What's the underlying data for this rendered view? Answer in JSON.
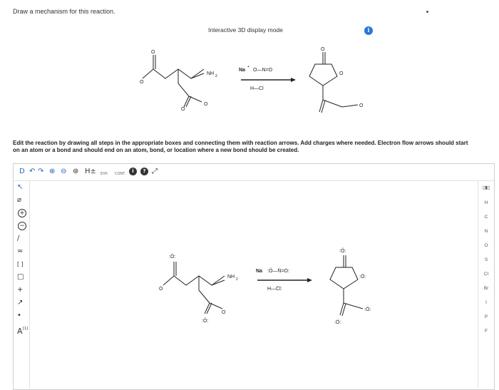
{
  "prompt": "Draw a mechanism for this reaction.",
  "display_mode_label": "Interactive 3D display mode",
  "info_badge": "i",
  "instructions": "Edit the reaction by drawing all steps in the appropriate boxes and connecting them with reaction arrows. Add charges where needed. Electron flow arrows should start on an atom or a bond and should end on an atom, bond, or location where a new bond should be created.",
  "reaction_top": {
    "reactant_amine": "NH",
    "reactant_amine_sub": "2",
    "o_minus": "O",
    "minus": "−",
    "o_label": "O",
    "reagent_cation": "Na",
    "plus": "+",
    "reagent_nitrite": "O—N=O",
    "reagent_acid": "H—Cl"
  },
  "reaction_canvas": {
    "reactant_amine": "NH",
    "reactant_amine_sub": "2",
    "reagent_cation": "Na",
    "reagent_nitrite": ":Ö—N̈=O:",
    "reagent_acid": "H—C̈l:",
    "o_lone": ":Ö:",
    "o_minus": "O"
  },
  "toolbar": {
    "items": [
      "D",
      "↶",
      "↷",
      "⊕",
      "⊖",
      "⊛",
      "H±",
      "EXP.",
      "CONT.",
      "i",
      "?",
      "⤢"
    ]
  },
  "left_tools": [
    "↖",
    "⌀",
    "+",
    "−",
    "∕",
    "≈",
    "[ ]",
    "□",
    "+",
    "↗",
    "•",
    "A"
  ],
  "left_tool_sup": "[1]",
  "right_tools": {
    "periodic_icon": "▯▮▯",
    "elements": [
      "H",
      "C",
      "N",
      "O",
      "S",
      "Cl",
      "Br",
      "I",
      "P",
      "F"
    ]
  },
  "colors": {
    "accent": "#2a78d6",
    "text": "#222222",
    "border": "#cfcfcf"
  }
}
